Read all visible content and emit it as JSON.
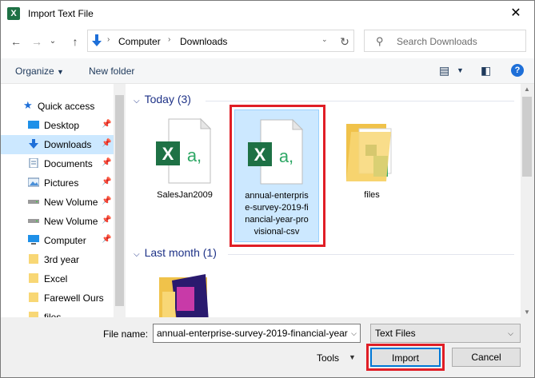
{
  "window": {
    "title": "Import Text File",
    "app_icon_text": "X",
    "close_glyph": "✕"
  },
  "nav": {
    "back_glyph": "←",
    "forward_glyph": "→",
    "recent_glyph": "⌄",
    "up_glyph": "↑",
    "breadcrumb": [
      "Computer",
      "Downloads"
    ],
    "refresh_glyph": "↻"
  },
  "search": {
    "placeholder": "Search Downloads",
    "icon_glyph": "⚲"
  },
  "toolbar": {
    "organize_label": "Organize",
    "new_folder_label": "New folder",
    "help_label": "?"
  },
  "sidebar": {
    "items": [
      {
        "label": "Quick access",
        "icon": "star-icon",
        "pinned": false
      },
      {
        "label": "Desktop",
        "icon": "desktop-icon",
        "pinned": true
      },
      {
        "label": "Downloads",
        "icon": "download-icon",
        "pinned": true,
        "selected": true
      },
      {
        "label": "Documents",
        "icon": "documents-icon",
        "pinned": true
      },
      {
        "label": "Pictures",
        "icon": "pictures-icon",
        "pinned": true
      },
      {
        "label": "New Volume",
        "icon": "drive-icon",
        "pinned": true
      },
      {
        "label": "New Volume",
        "icon": "drive-icon",
        "pinned": true
      },
      {
        "label": "Computer",
        "icon": "computer-icon",
        "pinned": true
      },
      {
        "label": "3rd year",
        "icon": "folder-icon",
        "pinned": false
      },
      {
        "label": "Excel",
        "icon": "folder-icon",
        "pinned": false
      },
      {
        "label": "Farewell Ours",
        "icon": "folder-icon",
        "pinned": false
      },
      {
        "label": "files",
        "icon": "folder-icon",
        "pinned": false
      }
    ]
  },
  "main": {
    "groups": [
      {
        "label": "Today (3)"
      },
      {
        "label": "Last month (1)"
      }
    ],
    "files": [
      {
        "name": "SalesJan2009",
        "type": "csv-file-icon",
        "selected": false
      },
      {
        "name": "annual-enterprise-survey-2019-financial-year-provisional-csv",
        "name_lines": [
          "annual-enterpris",
          "e-survey-2019-fi",
          "nancial-year-pro",
          "visional-csv"
        ],
        "type": "csv-file-icon",
        "selected": true
      },
      {
        "name": "files",
        "type": "folder-icon",
        "selected": false
      }
    ]
  },
  "bottom": {
    "file_name_label": "File name:",
    "file_name_value": "annual-enterprise-survey-2019-financial-year",
    "file_type_value": "Text Files",
    "tools_label": "Tools",
    "import_label": "Import",
    "cancel_label": "Cancel"
  },
  "colors": {
    "accent": "#0078d7",
    "highlight_red": "#e01e26",
    "selection": "#cce8ff",
    "excel_green": "#1e7145"
  }
}
